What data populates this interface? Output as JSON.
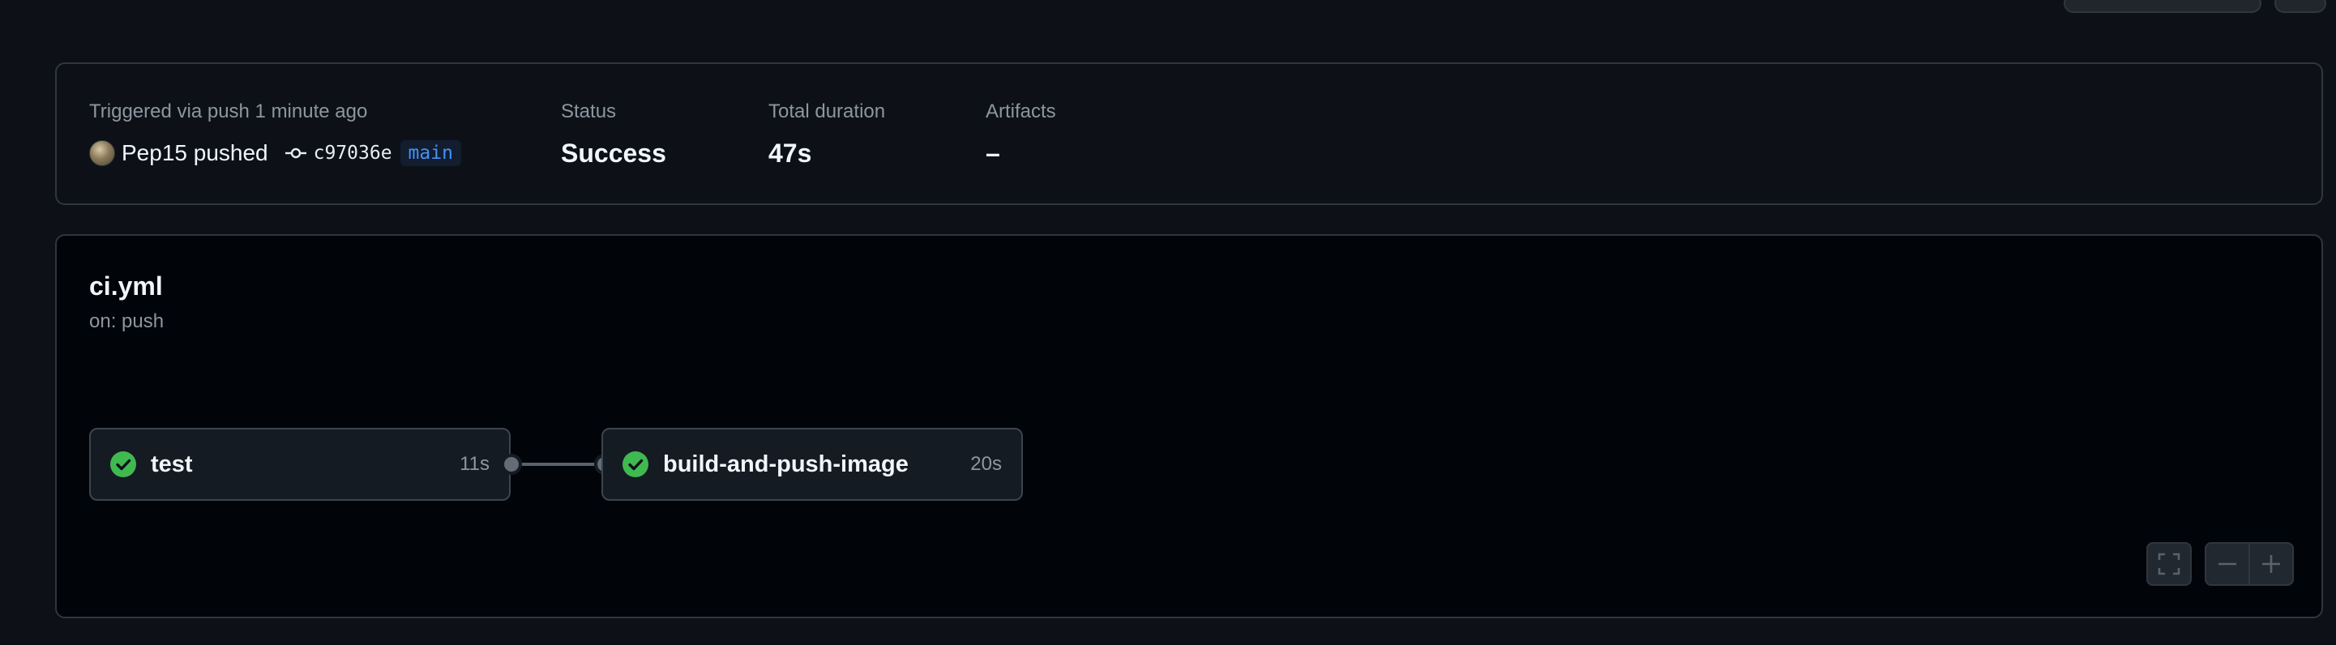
{
  "summary": {
    "trigger_label": "Triggered via push 1 minute ago",
    "actor": "Pep15 pushed",
    "commit_sha": "c97036e",
    "branch": "main",
    "status_label": "Status",
    "status_value": "Success",
    "duration_label": "Total duration",
    "duration_value": "47s",
    "artifacts_label": "Artifacts",
    "artifacts_value": "–"
  },
  "workflow": {
    "file": "ci.yml",
    "trigger": "on: push",
    "jobs": [
      {
        "name": "test",
        "duration": "11s",
        "status": "success"
      },
      {
        "name": "build-and-push-image",
        "duration": "20s",
        "status": "success"
      }
    ]
  },
  "controls": {
    "icons": [
      "fullscreen-icon",
      "zoom-out-icon",
      "zoom-in-icon"
    ]
  },
  "colors": {
    "background": "#0d1117",
    "graph_background": "#010409",
    "success": "#3fb950",
    "branch_text": "#4493f8",
    "border": "#30363d"
  }
}
